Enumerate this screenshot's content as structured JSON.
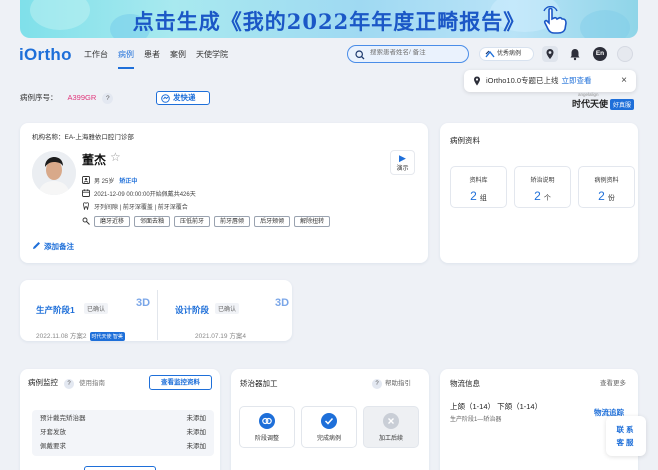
{
  "banner": {
    "text": "点击生成《我的2022年年度正畸报告》"
  },
  "header": {
    "logo": "iOrtho",
    "nav": [
      {
        "label": "工作台",
        "active": false
      },
      {
        "label": "病例",
        "active": true
      },
      {
        "label": "患者",
        "active": false
      },
      {
        "label": "案例",
        "active": false
      },
      {
        "label": "天使学院",
        "active": false
      }
    ],
    "search_placeholder": "搜索患者姓名/ 备注",
    "excellent_cases": "优秀病例",
    "lang": "En"
  },
  "notice": {
    "text": "iOrtho10.0专题已上线",
    "link": "立即查看",
    "close": "×"
  },
  "brand": {
    "small": "angelalign",
    "name": "时代天使",
    "tag": "好真服"
  },
  "case": {
    "label": "病例序号：",
    "number": "A399GR",
    "help": "?",
    "express": "发快递"
  },
  "patient": {
    "org": "机构名称：EA-上海雅依口腔门诊部",
    "name": "董杰",
    "gender_age": "男 25岁",
    "status": "矫正中",
    "start": "2021-12-09 00:00:00开始佩戴共426天",
    "diagnosis": "牙列间隙 | 前牙深覆盖 | 前牙深覆合",
    "chips": [
      "磨牙近移",
      "邻面去釉",
      "压低前牙",
      "前牙唇倾",
      "后牙颊倾",
      "解除扭转"
    ],
    "add_note": "添加备注",
    "demo": "演示"
  },
  "case_data": {
    "title": "病例资料",
    "boxes": [
      {
        "label": "资料库",
        "value": "2",
        "unit": "组"
      },
      {
        "label": "矫治说明",
        "value": "2",
        "unit": "个"
      },
      {
        "label": "病例资料",
        "value": "2",
        "unit": "份"
      }
    ]
  },
  "stages": [
    {
      "title": "生产阶段1",
      "tag": "已确认",
      "icon": "3D",
      "date": "2022.11.08",
      "plan": "方案2",
      "badge": "时代天使 智美"
    },
    {
      "title": "设计阶段",
      "tag": "已确认",
      "icon": "3D",
      "date": "2021.07.19",
      "plan": "方案4",
      "badge": ""
    }
  ],
  "monitor": {
    "title": "病例监控",
    "help": "?",
    "guide": "使用指南",
    "button": "查看监控资料",
    "rows": [
      {
        "label": "预计戴完矫治器",
        "value": "未添加"
      },
      {
        "label": "牙套发放",
        "value": "未添加"
      },
      {
        "label": "佩戴要求",
        "value": "未添加"
      }
    ]
  },
  "appliance": {
    "title": "矫治器加工",
    "help": "?",
    "help_label": "帮助指引",
    "tools": [
      {
        "label": "阶段调整"
      },
      {
        "label": "完成病例"
      },
      {
        "label": "加工后续"
      }
    ]
  },
  "logistics": {
    "title": "物流信息",
    "more": "查看更多",
    "main": "上颌（1-14） 下颌（1-14）",
    "sub": "生产阶段1—矫治器",
    "track": "物流追踪"
  },
  "contact": {
    "line1": "联系",
    "line2": "客服"
  },
  "colors": {
    "accent": "#1e6fd9",
    "case_number": "#e0357a",
    "banner_text": "#1b57c6"
  }
}
